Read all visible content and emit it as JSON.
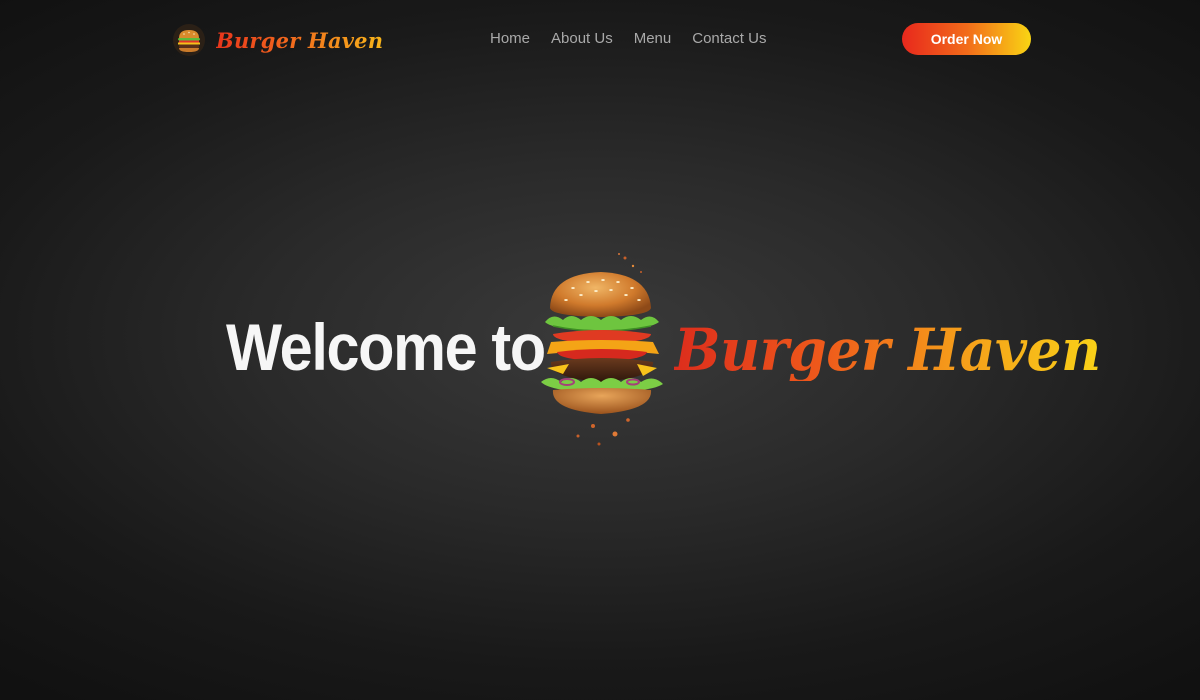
{
  "brand": {
    "name": "Burger Haven",
    "logo_icon": "burger-icon"
  },
  "nav": {
    "items": [
      {
        "label": "Home"
      },
      {
        "label": "About Us"
      },
      {
        "label": "Menu"
      },
      {
        "label": "Contact Us"
      }
    ]
  },
  "cta": {
    "label": "Order Now"
  },
  "hero": {
    "welcome": "Welcome to",
    "brand_name": "Burger Haven",
    "image": "burger-image"
  },
  "colors": {
    "background": "#1b1b1b",
    "accent_start": "#e8281d",
    "accent_mid": "#f26b1a",
    "accent_end": "#f9d514",
    "nav_text": "#a9a9a9",
    "heading_text": "#f6f6f6"
  }
}
